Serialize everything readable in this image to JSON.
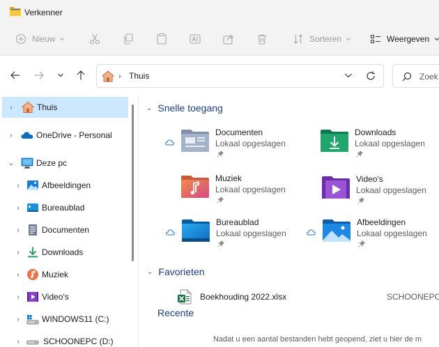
{
  "window": {
    "title": "Verkenner"
  },
  "toolbar": {
    "new_label": "Nieuw",
    "sort_label": "Sorteren",
    "view_label": "Weergeven"
  },
  "address": {
    "path": "Thuis",
    "search_placeholder": "Zoek"
  },
  "sidebar": {
    "items": [
      {
        "label": "Thuis",
        "icon": "home-icon",
        "selected": true
      },
      {
        "label": "OneDrive - Personal",
        "icon": "onedrive-icon"
      },
      {
        "label": "Deze pc",
        "icon": "pc-icon",
        "expanded": true
      },
      {
        "label": "Afbeeldingen",
        "icon": "pictures-icon"
      },
      {
        "label": "Bureaublad",
        "icon": "desktop-icon"
      },
      {
        "label": "Documenten",
        "icon": "documents-icon"
      },
      {
        "label": "Downloads",
        "icon": "downloads-icon"
      },
      {
        "label": "Muziek",
        "icon": "music-icon"
      },
      {
        "label": "Video's",
        "icon": "videos-icon"
      },
      {
        "label": "WINDOWS11 (C:)",
        "icon": "drive-c-icon"
      },
      {
        "label": "SCHOONEPC (D:)",
        "icon": "drive-d-icon"
      }
    ]
  },
  "quick_access": {
    "heading": "Snelle toegang",
    "tiles": [
      {
        "name": "Documenten",
        "sub": "Lokaal opgeslagen",
        "icon": "documents-folder-icon",
        "cloud": true
      },
      {
        "name": "Downloads",
        "sub": "Lokaal opgeslagen",
        "icon": "downloads-folder-icon",
        "cloud": false
      },
      {
        "name": "Muziek",
        "sub": "Lokaal opgeslagen",
        "icon": "music-folder-icon",
        "cloud": false
      },
      {
        "name": "Video's",
        "sub": "Lokaal opgeslagen",
        "icon": "videos-folder-icon",
        "cloud": false
      },
      {
        "name": "Bureaublad",
        "sub": "Lokaal opgeslagen",
        "icon": "desktop-folder-icon",
        "cloud": true
      },
      {
        "name": "Afbeeldingen",
        "sub": "Lokaal opgeslagen",
        "icon": "pictures-folder-icon",
        "cloud": true
      }
    ]
  },
  "favorites": {
    "heading": "Favorieten",
    "items": [
      {
        "name": "Boekhouding 2022.xlsx",
        "location": "SCHOONEPC"
      }
    ]
  },
  "recent": {
    "heading": "Recente",
    "message": "Nadat u een aantal bestanden hebt geopend, ziet u hier de m"
  },
  "colors": {
    "accent": "#0067c0",
    "selection": "#cce8ff",
    "heading": "#1e3e7a"
  }
}
